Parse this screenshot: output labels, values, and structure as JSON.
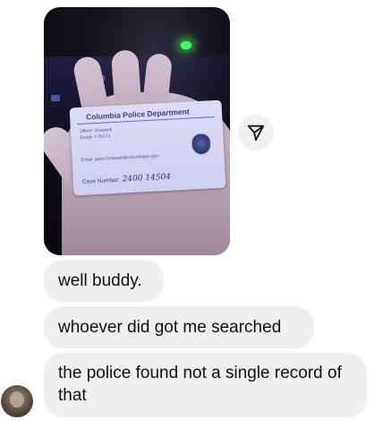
{
  "photo": {
    "description_icon": "photo-of-police-id-card",
    "card": {
      "title": "Columbia Police Department",
      "officer_line": "Officer: Braswell",
      "badge_line": "Badge # 26173",
      "email_line": "Email: jason.braswell@columbiasc.gov",
      "case_label": "Case Number:",
      "case_value": "2400 14504"
    }
  },
  "share_button": {
    "icon": "send-arrow-icon"
  },
  "messages": [
    {
      "text": "well buddy."
    },
    {
      "text": "whoever did got me searched"
    },
    {
      "text": "the police found not a single record of that"
    }
  ],
  "colors": {
    "bubble_bg": "#efeff1",
    "text": "#111111",
    "background": "#ffffff"
  }
}
